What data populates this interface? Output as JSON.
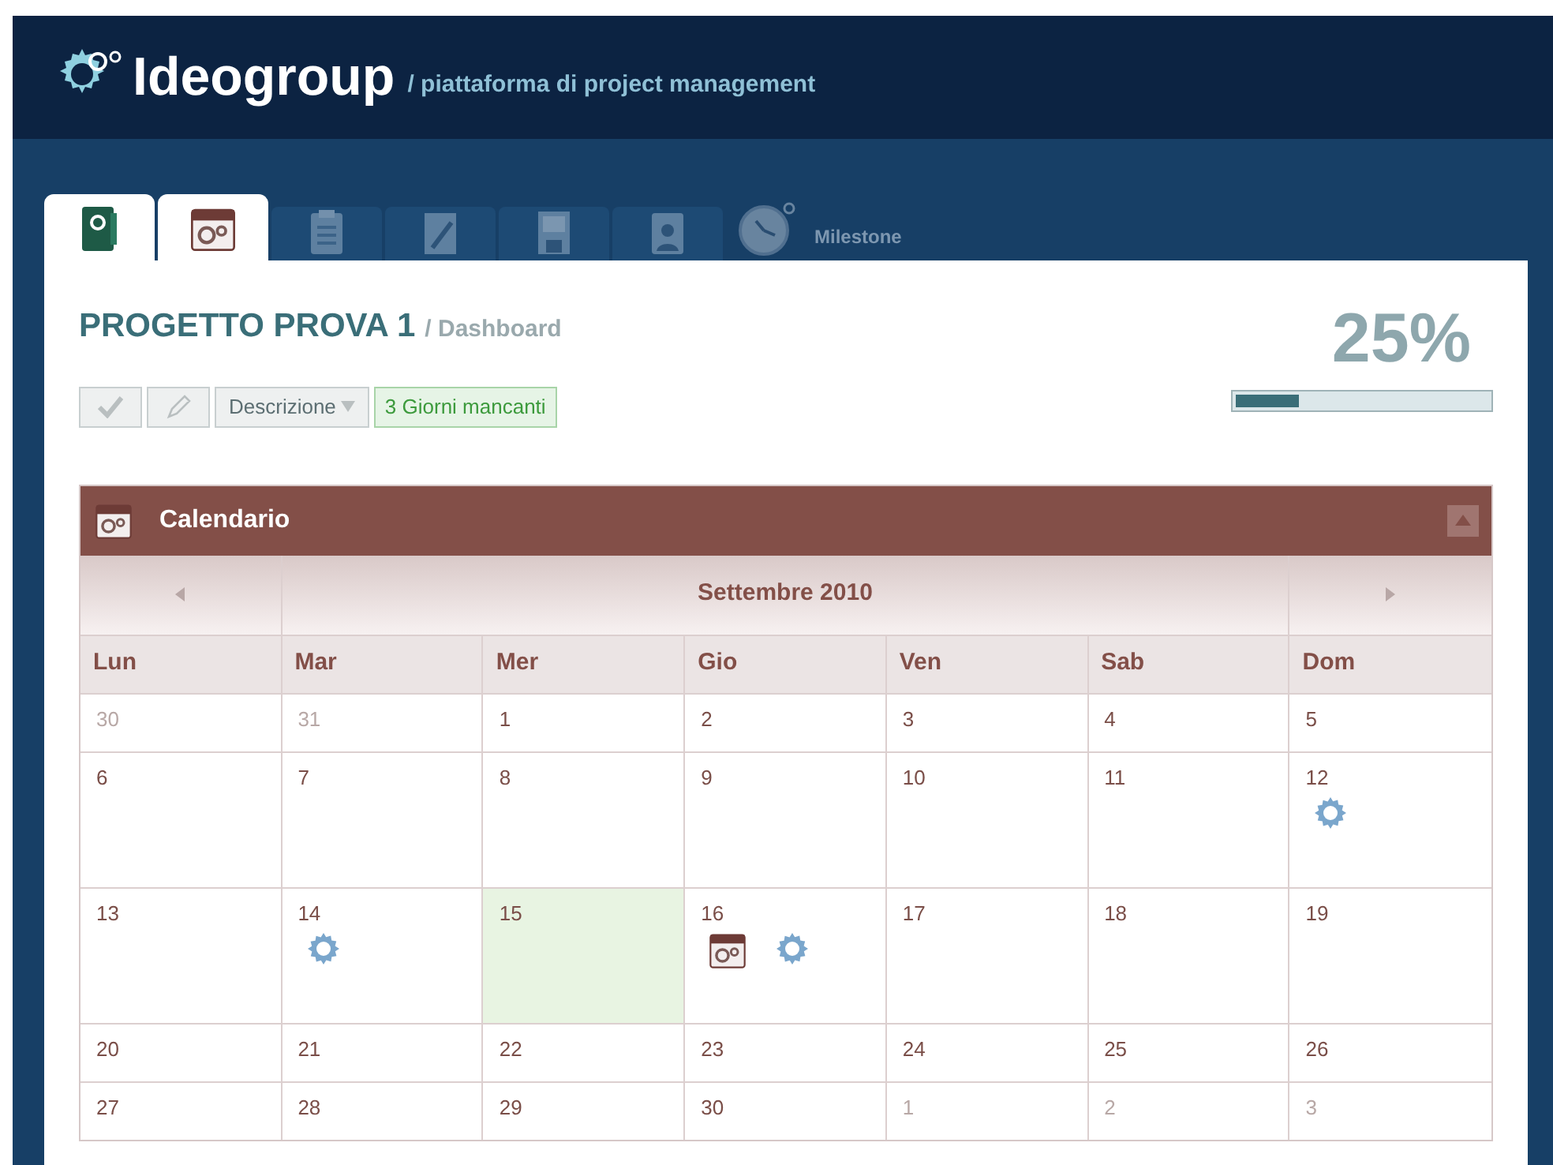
{
  "header": {
    "brand": "Ideogroup",
    "subtitle": "/ piattaforma di project management"
  },
  "tabs": [
    {
      "kind": "folder",
      "selected": true
    },
    {
      "kind": "calendar",
      "selected": true
    },
    {
      "kind": "checklist",
      "selected": false
    },
    {
      "kind": "notepad",
      "selected": false
    },
    {
      "kind": "floppy",
      "selected": false
    },
    {
      "kind": "badge",
      "selected": false
    },
    {
      "kind": "clock",
      "selected": false,
      "label": "Milestone"
    }
  ],
  "project": {
    "title": "PROGETTO PROVA 1",
    "section": "/ Dashboard",
    "percent": "25%",
    "level": 0.25,
    "actions": [
      {
        "kind": "check"
      },
      {
        "kind": "pencil"
      },
      {
        "kind": "dropdown",
        "label": "Descrizione"
      },
      {
        "kind": "status",
        "label": "3 Giorni mancanti"
      }
    ]
  },
  "calendar": {
    "title": "Calendario",
    "month": "Settembre 2010",
    "weekdays": [
      "Lun",
      "Mar",
      "Mer",
      "Gio",
      "Ven",
      "Sab",
      "Dom"
    ],
    "weeks": [
      [
        {
          "day": "30",
          "muted": true
        },
        {
          "day": "31",
          "muted": true
        },
        {
          "day": "1",
          "muted": false
        },
        {
          "day": "2",
          "muted": false
        },
        {
          "day": "3",
          "muted": false
        },
        {
          "day": "4",
          "muted": false
        },
        {
          "day": "5",
          "muted": false
        }
      ],
      [
        {
          "day": "6",
          "muted": false
        },
        {
          "day": "7",
          "muted": false
        },
        {
          "day": "8",
          "muted": false
        },
        {
          "day": "9",
          "muted": false
        },
        {
          "day": "10",
          "muted": false
        },
        {
          "day": "11",
          "muted": false
        },
        {
          "day": "12",
          "muted": false,
          "events": [
            {
              "kind": "gear"
            }
          ]
        }
      ],
      [
        {
          "day": "13",
          "muted": false
        },
        {
          "day": "14",
          "muted": false,
          "events": [
            {
              "kind": "gear"
            }
          ]
        },
        {
          "day": "15",
          "muted": false,
          "today": true
        },
        {
          "day": "16",
          "muted": false,
          "events": [
            {
              "kind": "calendar"
            },
            {
              "kind": "gear"
            }
          ]
        },
        {
          "day": "17",
          "muted": false
        },
        {
          "day": "18",
          "muted": false
        },
        {
          "day": "19",
          "muted": false
        }
      ],
      [
        {
          "day": "20",
          "muted": false
        },
        {
          "day": "21",
          "muted": false
        },
        {
          "day": "22",
          "muted": false
        },
        {
          "day": "23",
          "muted": false
        },
        {
          "day": "24",
          "muted": false
        },
        {
          "day": "25",
          "muted": false
        },
        {
          "day": "26",
          "muted": false
        }
      ],
      [
        {
          "day": "27",
          "muted": false
        },
        {
          "day": "28",
          "muted": false
        },
        {
          "day": "29",
          "muted": false
        },
        {
          "day": "30",
          "muted": false
        },
        {
          "day": "1",
          "muted": true
        },
        {
          "day": "2",
          "muted": true
        },
        {
          "day": "3",
          "muted": true
        }
      ]
    ]
  }
}
